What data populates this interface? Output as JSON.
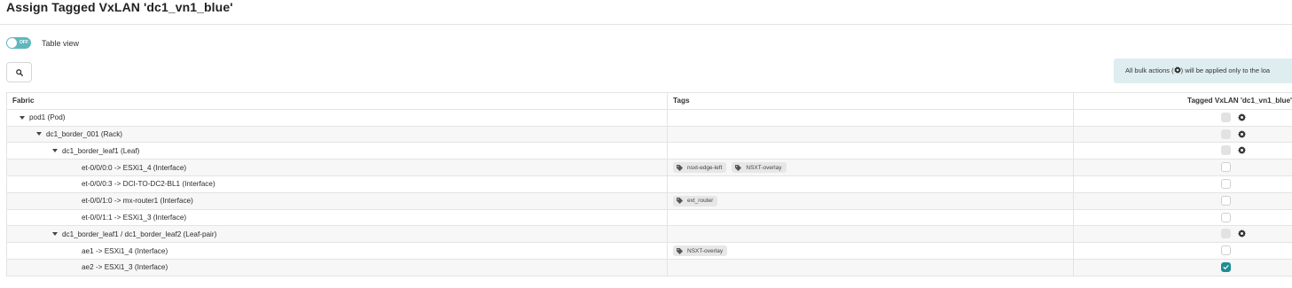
{
  "page": {
    "title": "Assign Tagged VxLAN 'dc1_vn1_blue'"
  },
  "controls": {
    "toggle_state": "OFF",
    "toggle_label": "Table view",
    "search_icon": "search-icon",
    "info_text_before": "All bulk actions (",
    "info_text_after": ") will be applied only to the loa"
  },
  "table": {
    "headers": {
      "fabric": "Fabric",
      "tags": "Tags",
      "vxlan": "Tagged VxLAN 'dc1_vn1_blue'"
    },
    "rows": [
      {
        "label": "pod1 (Pod)",
        "level": 0,
        "expandable": true,
        "tags": [],
        "checkbox": "disabled",
        "gear": true
      },
      {
        "label": "dc1_border_001 (Rack)",
        "level": 1,
        "expandable": true,
        "tags": [],
        "checkbox": "disabled",
        "gear": true
      },
      {
        "label": "dc1_border_leaf1 (Leaf)",
        "level": 2,
        "expandable": true,
        "tags": [],
        "checkbox": "disabled",
        "gear": true
      },
      {
        "label": "et-0/0/0:0 -> ESXi1_4 (Interface)",
        "level": 3,
        "expandable": false,
        "tags": [
          "nsxt-edge-left",
          "NSXT-overlay"
        ],
        "checkbox": "unchecked",
        "gear": false
      },
      {
        "label": "et-0/0/0:3 -> DCI-TO-DC2-BL1 (Interface)",
        "level": 3,
        "expandable": false,
        "tags": [],
        "checkbox": "unchecked",
        "gear": false
      },
      {
        "label": "et-0/0/1:0 -> mx-router1 (Interface)",
        "level": 3,
        "expandable": false,
        "tags": [
          "ext_router"
        ],
        "checkbox": "unchecked",
        "gear": false
      },
      {
        "label": "et-0/0/1:1 -> ESXi1_3 (Interface)",
        "level": 3,
        "expandable": false,
        "tags": [],
        "checkbox": "unchecked",
        "gear": false
      },
      {
        "label": "dc1_border_leaf1 / dc1_border_leaf2 (Leaf-pair)",
        "level": 2,
        "expandable": true,
        "tags": [],
        "checkbox": "disabled",
        "gear": true
      },
      {
        "label": "ae1 -> ESXi1_4 (Interface)",
        "level": 3,
        "expandable": false,
        "tags": [
          "NSXT-overlay"
        ],
        "checkbox": "unchecked",
        "gear": false
      },
      {
        "label": "ae2 -> ESXi1_3 (Interface)",
        "level": 3,
        "expandable": false,
        "tags": [],
        "checkbox": "checked",
        "gear": false
      }
    ]
  },
  "colors": {
    "accent": "#1f8e93",
    "toggle": "#5fb7bd",
    "info_bg": "#deeef0"
  }
}
